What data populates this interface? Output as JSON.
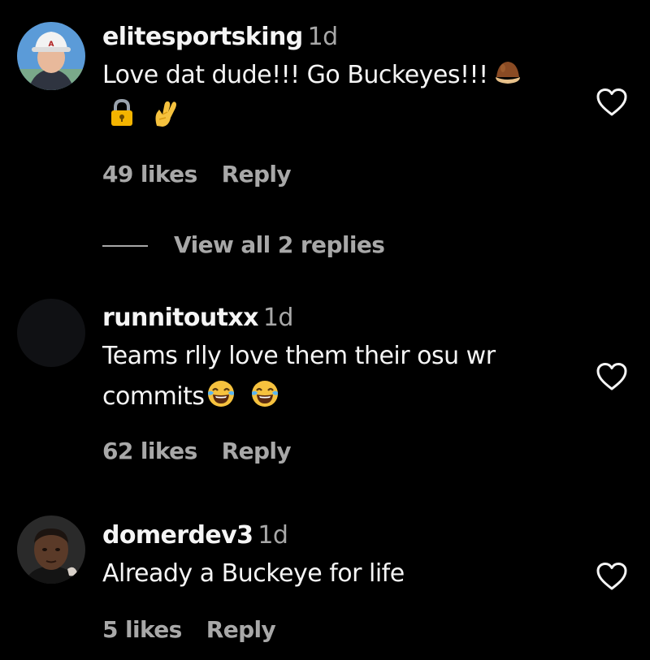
{
  "comments": [
    {
      "username": "elitesportsking",
      "time": "1d",
      "text_line1": "Love dat dude!!! Go Buckeyes!!!",
      "text_line1_emojis": [
        "chestnut-emoji"
      ],
      "text_line2_emojis": [
        "locked-padlock-emoji",
        "crossed-fingers-emoji"
      ],
      "likes": "49 likes",
      "reply": "Reply",
      "view_replies": "View all 2 replies"
    },
    {
      "username": "runnitoutxx",
      "time": "1d",
      "text_line1": "Teams rlly love them their osu wr",
      "text_line2": "commits",
      "text_line2_emojis": [
        "face-with-tears-of-joy-emoji",
        "face-with-tears-of-joy-emoji"
      ],
      "likes": "62 likes",
      "reply": "Reply"
    },
    {
      "username": "domerdev3",
      "time": "1d",
      "text_line1": "Already a Buckeye for life",
      "likes": "5 likes",
      "reply": "Reply"
    }
  ],
  "colors": {
    "background": "#000000",
    "primary_text": "#f5f5f5",
    "secondary_text": "#a8a8a8"
  },
  "icons": {
    "like": "heart-outline-icon"
  }
}
